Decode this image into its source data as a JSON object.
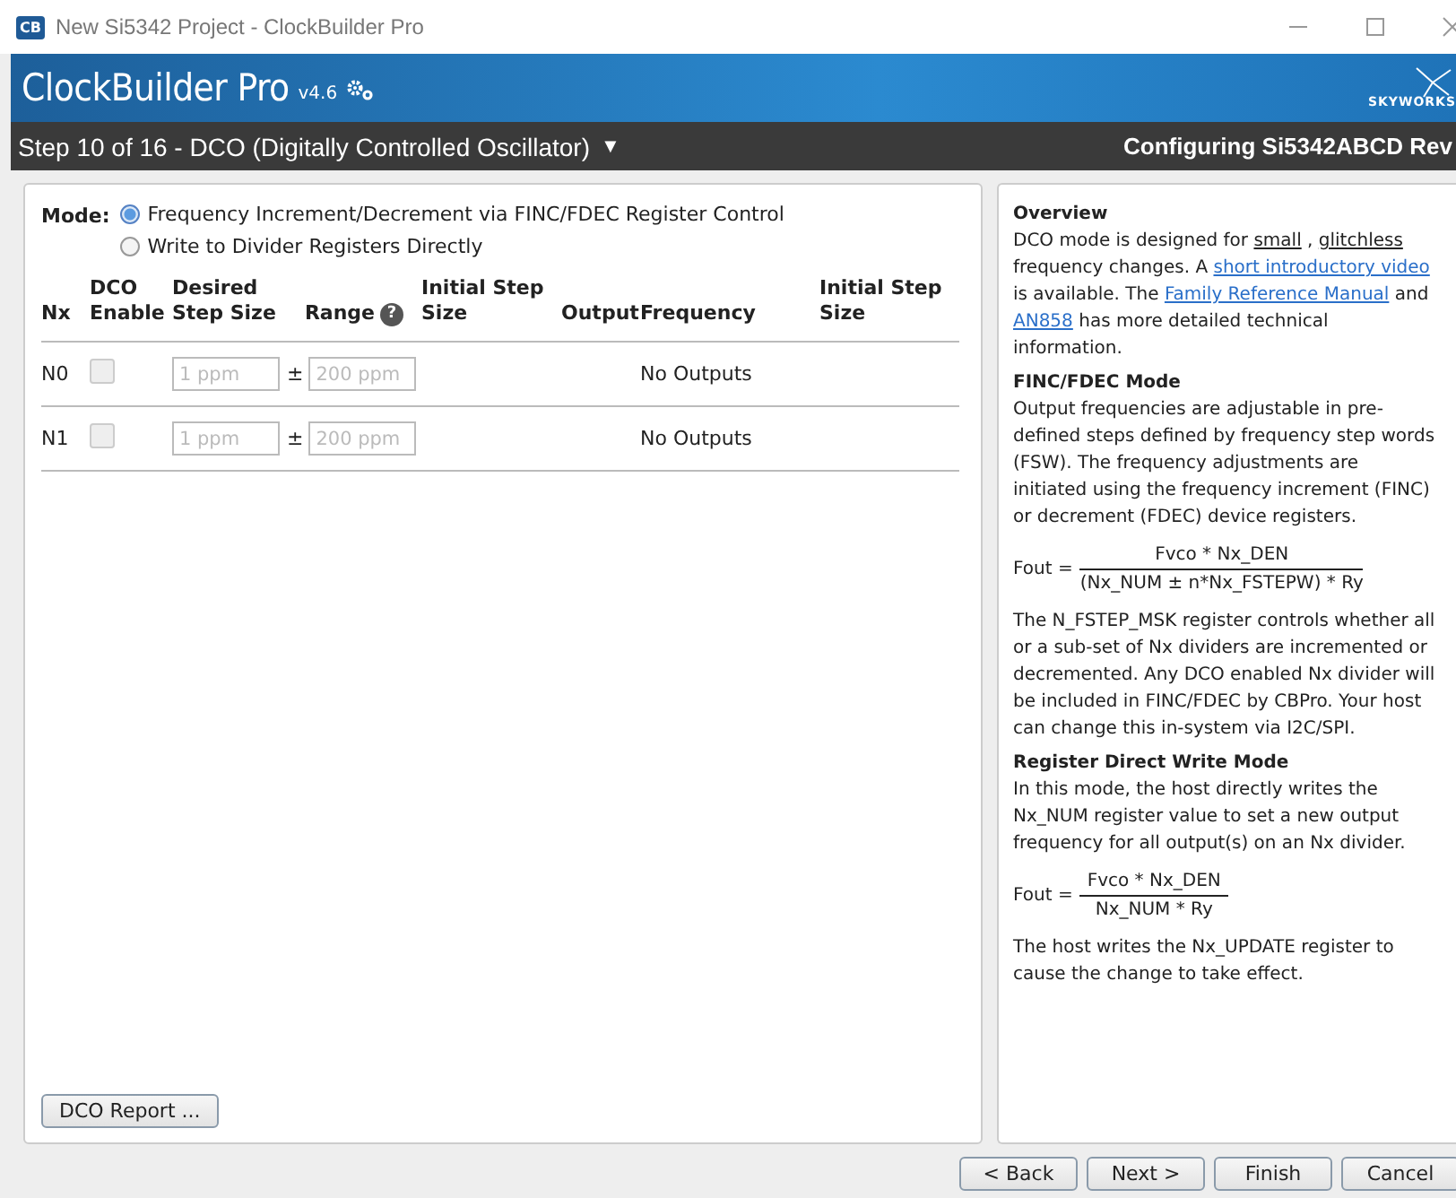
{
  "window": {
    "app_badge": "CB",
    "title": "New Si5342 Project - ClockBuilder Pro"
  },
  "header": {
    "product": "ClockBuilder Pro",
    "version": "v4.6",
    "brand": "SKYWORKS"
  },
  "step_bar": {
    "step": "Step 10 of 16 - DCO (Digitally Controlled Oscillator)",
    "menu_glyph": "▼",
    "configuring": "Configuring Si5342ABCD Rev"
  },
  "mode": {
    "label": "Mode:",
    "options": [
      {
        "label": "Frequency Increment/Decrement via FINC/FDEC Register Control",
        "selected": true
      },
      {
        "label": "Write to Divider Registers Directly",
        "selected": false
      }
    ]
  },
  "table": {
    "columns": [
      {
        "label": "Nx"
      },
      {
        "label": "DCO Enable"
      },
      {
        "label": "Desired Step Size"
      },
      {
        "label": "Range",
        "help": "?"
      },
      {
        "label": "Initial Step Size"
      },
      {
        "label": "Output"
      },
      {
        "label": "Frequency"
      },
      {
        "label": "Initial Step Size"
      }
    ],
    "rows": [
      {
        "nx": "N0",
        "enabled": false,
        "disabled": true,
        "step": "1 ppm",
        "pm": "±",
        "range": "200 ppm",
        "frequency": "No Outputs"
      },
      {
        "nx": "N1",
        "enabled": false,
        "disabled": true,
        "step": "1 ppm",
        "pm": "±",
        "range": "200 ppm",
        "frequency": "No Outputs"
      }
    ]
  },
  "report_button": "DCO Report ...",
  "help": [
    {
      "kind": "heading",
      "text": "Overview"
    },
    {
      "kind": "paragraph",
      "parts": [
        {
          "kind": "plain",
          "text": "DCO mode is designed for "
        },
        {
          "kind": "underline",
          "text": "small"
        },
        {
          "kind": "plain",
          "text": " , "
        },
        {
          "kind": "underline",
          "text": "glitchless"
        },
        {
          "kind": "plain",
          "text": " frequency changes. A "
        },
        {
          "kind": "link",
          "text": "short introductory video"
        },
        {
          "kind": "plain",
          "text": " is available. The "
        },
        {
          "kind": "link",
          "text": "Family Reference Manual"
        },
        {
          "kind": "plain",
          "text": " and "
        },
        {
          "kind": "link",
          "text": "AN858"
        },
        {
          "kind": "plain",
          "text": " has more detailed technical information."
        }
      ]
    },
    {
      "kind": "heading",
      "text": "FINC/FDEC Mode"
    },
    {
      "kind": "paragraph",
      "parts": [
        {
          "kind": "plain",
          "text": "Output frequencies are adjustable in pre-defined steps defined by frequency step words (FSW). The frequency adjustments are initiated using the frequency increment (FINC) or decrement (FDEC) device registers."
        }
      ]
    },
    {
      "kind": "formula",
      "lhs": "Fout =",
      "numerator": "Fvco * Nx_DEN",
      "denominator": "(Nx_NUM ± n*Nx_FSTEPW) * Ry"
    },
    {
      "kind": "paragraph",
      "parts": [
        {
          "kind": "plain",
          "text": "The N_FSTEP_MSK register controls whether all or a sub-set of Nx dividers are incremented or decremented. Any DCO enabled Nx divider will be included in FINC/FDEC by CBPro. Your host can change this in-system via I2C/SPI."
        }
      ]
    },
    {
      "kind": "heading",
      "text": "Register Direct Write Mode"
    },
    {
      "kind": "paragraph",
      "parts": [
        {
          "kind": "plain",
          "text": "In this mode, the host directly writes the Nx_NUM register value to set a new output frequency for all output(s) on an Nx divider."
        }
      ]
    },
    {
      "kind": "formula",
      "lhs": "Fout =",
      "numerator": "Fvco * Nx_DEN",
      "denominator": "Nx_NUM * Ry"
    },
    {
      "kind": "paragraph",
      "parts": [
        {
          "kind": "plain",
          "text": "The host writes the Nx_UPDATE register to cause the change to take effect."
        }
      ]
    }
  ],
  "buttons": [
    {
      "label": "< Back"
    },
    {
      "label": "Next >"
    },
    {
      "label": "Finish"
    },
    {
      "label": "Cancel"
    }
  ]
}
